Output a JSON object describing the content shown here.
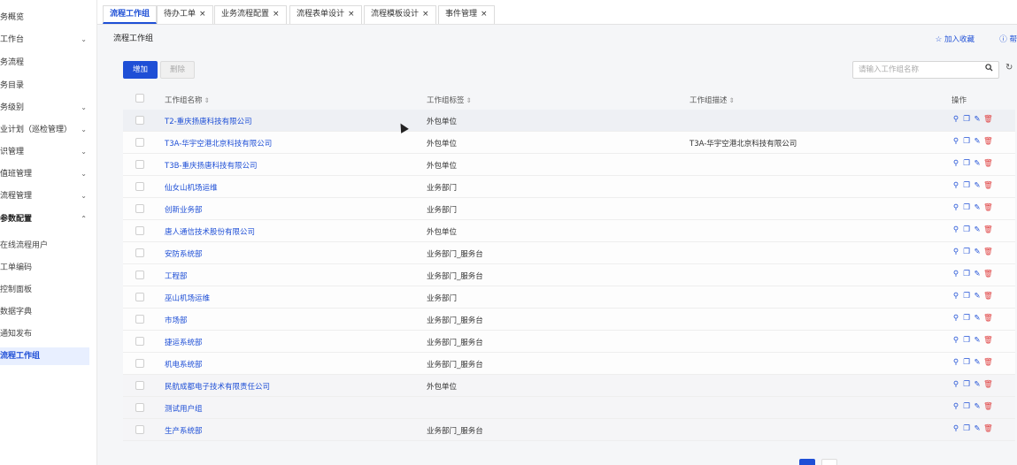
{
  "sidebar": {
    "items": [
      {
        "label": "务概览",
        "chevron": ""
      },
      {
        "label": "工作台",
        "chevron": "⌄"
      },
      {
        "label": "务流程",
        "chevron": ""
      },
      {
        "label": "务目录",
        "chevron": ""
      },
      {
        "label": "务级别",
        "chevron": "⌄"
      },
      {
        "label": "业计划（巡检管理）",
        "chevron": "⌄"
      },
      {
        "label": "识管理",
        "chevron": "⌄"
      },
      {
        "label": "值班管理",
        "chevron": "⌄"
      },
      {
        "label": "流程管理",
        "chevron": "⌄"
      },
      {
        "label": "参数配置",
        "chevron": "⌃"
      },
      {
        "label": "在线流程用户",
        "chevron": ""
      },
      {
        "label": "工单编码",
        "chevron": ""
      },
      {
        "label": "控制面板",
        "chevron": ""
      },
      {
        "label": "数据字典",
        "chevron": ""
      },
      {
        "label": "通知发布",
        "chevron": ""
      },
      {
        "label": "流程工作组",
        "chevron": ""
      }
    ]
  },
  "tabs": [
    {
      "label": "流程工作组",
      "close": ""
    },
    {
      "label": "待办工单",
      "close": "×"
    },
    {
      "label": "业务流程配置",
      "close": "×"
    },
    {
      "label": "流程表单设计",
      "close": "×"
    },
    {
      "label": "流程模板设计",
      "close": "×"
    },
    {
      "label": "事件管理",
      "close": "×"
    }
  ],
  "page": {
    "title": "流程工作组",
    "favorite": "☆ 加入收藏",
    "help": "ⓘ 帮"
  },
  "toolbar": {
    "add_label": "增加",
    "delete_label": "删除",
    "search_placeholder": "请输入工作组名称",
    "search_icon": "🔍",
    "refresh_icon": "↻"
  },
  "table": {
    "headers": {
      "name": "工作组名称",
      "tag": "工作组标签",
      "desc": "工作组描述",
      "ops": "操作",
      "sort_icon": "⇕"
    },
    "op_icons": {
      "user": "⚲",
      "copy": "❐",
      "edit": "✎",
      "delete": "🗑"
    },
    "rows": [
      {
        "name": "T2-重庆扬唐科技有限公司",
        "tag": "外包单位",
        "desc": ""
      },
      {
        "name": "T3A-华宇空港北京科技有限公司",
        "tag": "外包单位",
        "desc": "T3A-华宇空港北京科技有限公司"
      },
      {
        "name": "T3B-重庆扬唐科技有限公司",
        "tag": "外包单位",
        "desc": ""
      },
      {
        "name": "仙女山机场运维",
        "tag": "业务部门",
        "desc": ""
      },
      {
        "name": "创新业务部",
        "tag": "业务部门",
        "desc": ""
      },
      {
        "name": "唐人通信技术股份有限公司",
        "tag": "外包单位",
        "desc": ""
      },
      {
        "name": "安防系统部",
        "tag": "业务部门_服务台",
        "desc": ""
      },
      {
        "name": "工程部",
        "tag": "业务部门_服务台",
        "desc": ""
      },
      {
        "name": "巫山机场运维",
        "tag": "业务部门",
        "desc": ""
      },
      {
        "name": "市场部",
        "tag": "业务部门_服务台",
        "desc": ""
      },
      {
        "name": "捷运系统部",
        "tag": "业务部门_服务台",
        "desc": ""
      },
      {
        "name": "机电系统部",
        "tag": "业务部门_服务台",
        "desc": ""
      },
      {
        "name": "民航成都电子技术有限责任公司",
        "tag": "外包单位",
        "desc": ""
      },
      {
        "name": "测试用户组",
        "tag": "",
        "desc": ""
      },
      {
        "name": "生产系统部",
        "tag": "业务部门_服务台",
        "desc": ""
      }
    ]
  },
  "colors": {
    "accent": "#1e4fd6",
    "danger": "#e04848"
  }
}
